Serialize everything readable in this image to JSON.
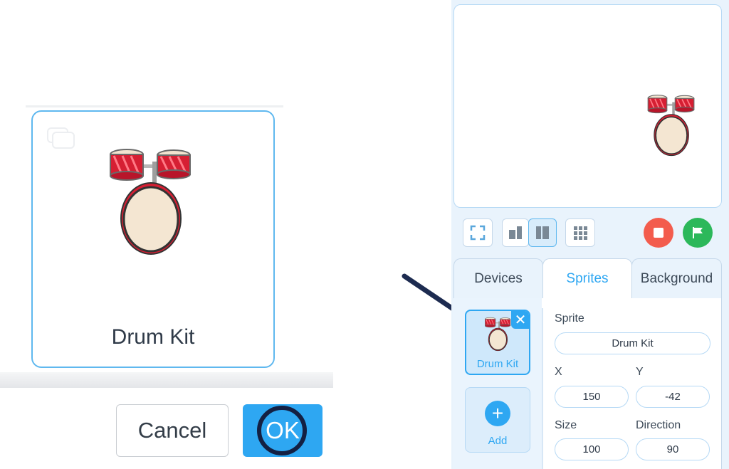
{
  "picker": {
    "card_label": "Drum Kit",
    "cancel_label": "Cancel",
    "ok_label": "OK"
  },
  "stage_toolbar": {
    "icons": [
      "fullscreen-icon",
      "small-stage-icon",
      "large-stage-icon",
      "grid-icon"
    ],
    "stop_color": "#f35c4d",
    "go_color": "#2cb85a"
  },
  "tabs": [
    "Devices",
    "Sprites",
    "Background"
  ],
  "active_tab": "Sprites",
  "sprites": {
    "items": [
      {
        "label": "Drum Kit",
        "close": "✕"
      }
    ],
    "add_label": "Add",
    "add_symbol": "+"
  },
  "properties": {
    "sprite_label": "Sprite",
    "sprite_name": "Drum Kit",
    "x_label": "X",
    "x_value": "150",
    "y_label": "Y",
    "y_value": "-42",
    "size_label": "Size",
    "size_value": "100",
    "direction_label": "Direction",
    "direction_value": "90"
  },
  "colors": {
    "accent": "#2ea7f2",
    "highlight_ring": "#132043",
    "panel_bg": "#e9f3fc"
  }
}
